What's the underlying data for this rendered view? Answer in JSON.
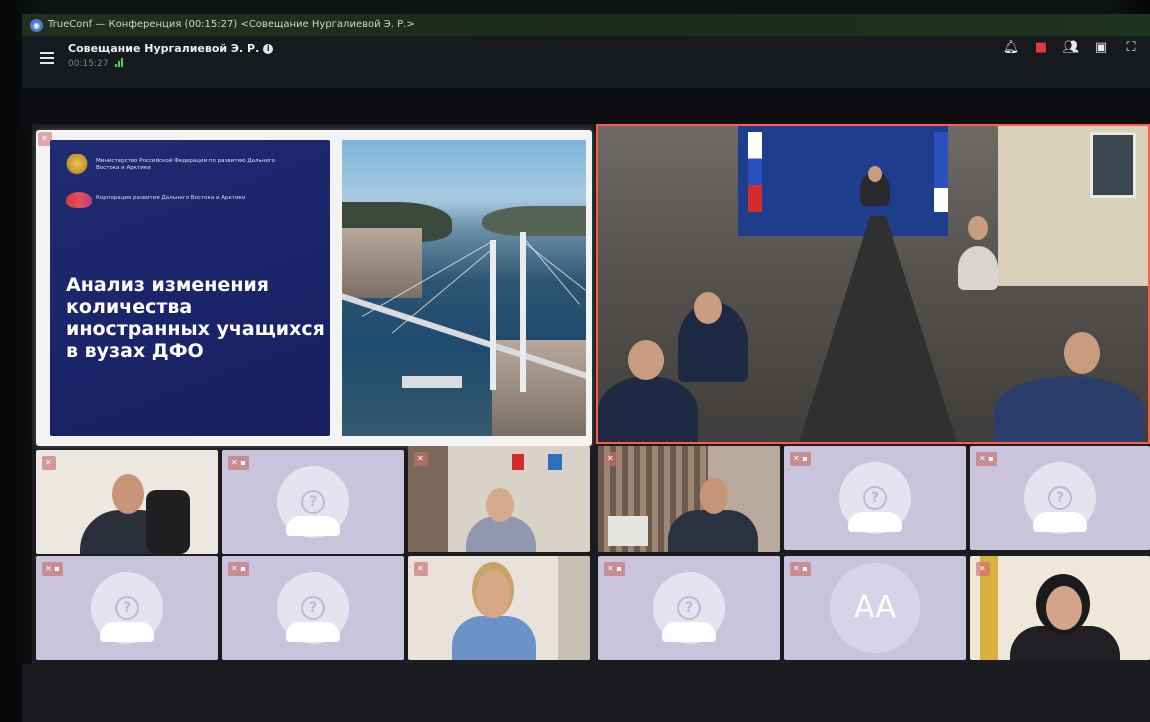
{
  "window": {
    "title": "TrueConf — Конференция (00:15:27) <Совещание Нургалиевой Э. Р.>",
    "app_icon": "trueconf-logo-icon"
  },
  "conference": {
    "name": "Совещание Нургалиевой Э. Р.",
    "elapsed": "00:15:27"
  },
  "toolbar": {
    "icons": [
      "notifications-icon",
      "chat-icon",
      "participants-icon",
      "self-view-icon",
      "fullscreen-icon"
    ],
    "chat_color": "#e03a3a"
  },
  "slide": {
    "ministry": "Министерство Российской Федерации по развитию Дальнего Востока и Арктики",
    "corporation": "Корпорация развития Дальнего Востока и Арктики",
    "headline": "Анализ изменения количества иностранных учащихся в вузах ДФО"
  },
  "tiles": [
    {
      "kind": "video",
      "badge": "mic-off"
    },
    {
      "kind": "avatar",
      "badge": "mic-off cam-off"
    },
    {
      "kind": "video",
      "badge": "mic-off"
    },
    {
      "kind": "video",
      "badge": "mic-off"
    },
    {
      "kind": "avatar",
      "badge": "mic-off cam-off"
    },
    {
      "kind": "avatar",
      "badge": "mic-off cam-off"
    },
    {
      "kind": "avatar",
      "badge": "mic-off cam-off"
    },
    {
      "kind": "avatar",
      "badge": "mic-off cam-off"
    },
    {
      "kind": "video",
      "badge": "mic-off"
    },
    {
      "kind": "avatar",
      "badge": "mic-off cam-off"
    },
    {
      "kind": "initials",
      "initials": "AA",
      "badge": "mic-off cam-off"
    },
    {
      "kind": "video",
      "badge": "mic-off"
    }
  ],
  "colors": {
    "active_speaker_border": "#ff5a4a",
    "signal": "#3ed35a",
    "tile_bg": "#c9c4dc"
  }
}
